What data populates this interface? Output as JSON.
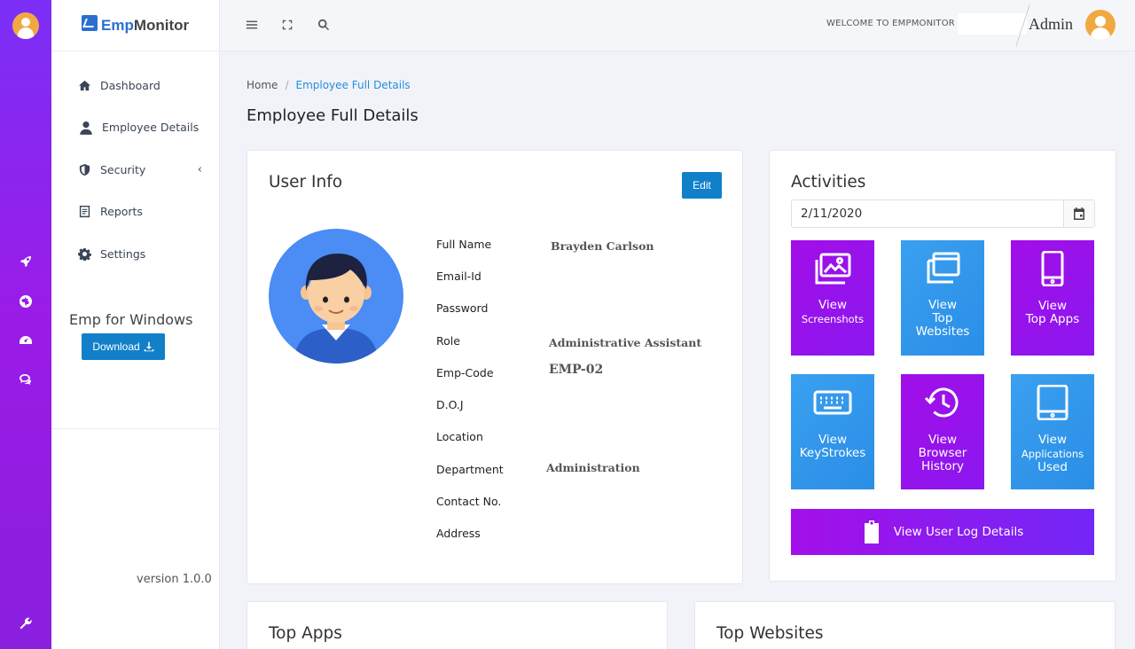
{
  "brand": {
    "logo_prefix": "Emp",
    "logo_suffix": "Monitor"
  },
  "sidebar": {
    "items": [
      {
        "label": "Dashboard",
        "icon": "home-icon"
      },
      {
        "label": "Employee Details",
        "icon": "employee-icon"
      },
      {
        "label": "Security",
        "icon": "shield-icon",
        "chevron": "‹"
      },
      {
        "label": "Reports",
        "icon": "report-icon"
      },
      {
        "label": "Settings",
        "icon": "gear-icon"
      }
    ],
    "emp_for_windows": "Emp for Windows",
    "download_label": "Download",
    "version": "version 1.0.0"
  },
  "rail": {
    "icons": [
      "rocket-icon",
      "globe-icon",
      "dashboard-icon",
      "chat-icon",
      "wrench-icon"
    ]
  },
  "topbar": {
    "welcome": "WELCOME TO EMPMONITOR",
    "user_name": "Admin"
  },
  "breadcrumb": {
    "home": "Home",
    "separator": "/",
    "current": "Employee Full Details"
  },
  "page_title": "Employee Full Details",
  "user_info": {
    "title": "User Info",
    "edit_label": "Edit",
    "fields": [
      {
        "label": "Full Name",
        "value": "Brayden Carlson"
      },
      {
        "label": "Email-Id",
        "value": ""
      },
      {
        "label": "Password",
        "value": ""
      },
      {
        "label": "Role",
        "value": "Administrative Assistant"
      },
      {
        "label": "Emp-Code",
        "value": "EMP-02"
      },
      {
        "label": "D.O.J",
        "value": ""
      },
      {
        "label": "Location",
        "value": ""
      },
      {
        "label": "Department",
        "value": "Administration"
      },
      {
        "label": "Contact No.",
        "value": ""
      },
      {
        "label": "Address",
        "value": ""
      }
    ]
  },
  "activities": {
    "title": "Activities",
    "date": "2/11/2020",
    "tiles": [
      {
        "line1": "View",
        "line2": "Screenshots",
        "line3": "",
        "color": "#a20ee8",
        "icon": "images-icon"
      },
      {
        "line1": "View",
        "line2": "Top",
        "line3": "Websites",
        "color": "#3aa0f0",
        "icon": "windows-icon"
      },
      {
        "line1": "View",
        "line2": "Top Apps",
        "line3": "",
        "color": "#a20ee8",
        "icon": "mobile-icon"
      },
      {
        "line1": "View",
        "line2": "KeyStrokes",
        "line3": "",
        "color": "#3aa0f0",
        "icon": "keyboard-icon"
      },
      {
        "line1": "View",
        "line2": "Browser",
        "line3": "History",
        "color": "#a20ee8",
        "icon": "history-icon"
      },
      {
        "line1": "View",
        "line2": "Applications",
        "line3": "Used",
        "color": "#3aa0f0",
        "icon": "tablet-icon"
      }
    ],
    "log_label": "View User Log Details"
  },
  "bottom": {
    "top_apps": "Top Apps",
    "top_websites": "Top Websites"
  },
  "colors": {
    "primary_blue": "#1180c8",
    "purple": "#a20ee8",
    "tile_blue": "#3aa0f0",
    "rail": "#7b2ff7"
  }
}
